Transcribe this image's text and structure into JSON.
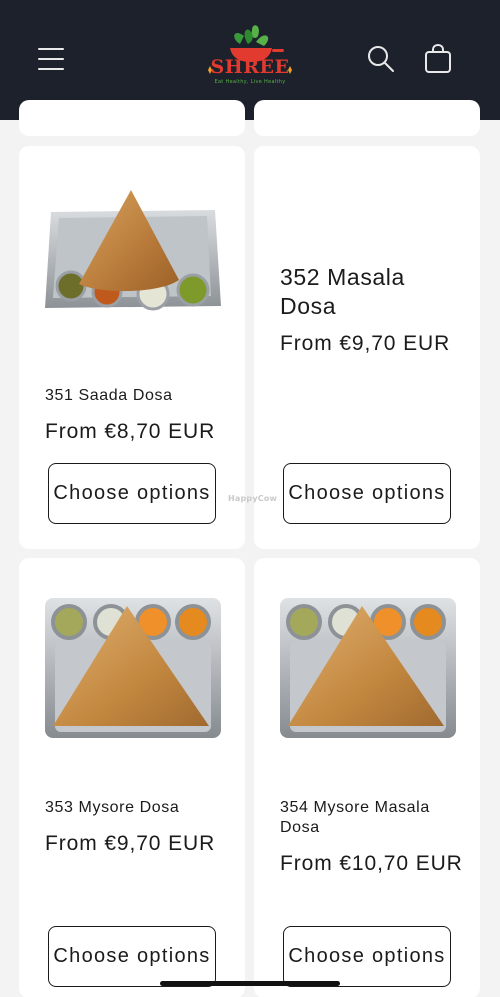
{
  "header": {
    "logo_text": "SHREE",
    "logo_tagline": "Eat Healthy, Live Healthy",
    "background": "#1c212b",
    "icons": [
      "menu-icon",
      "search-icon",
      "cart-icon"
    ]
  },
  "products": [
    {
      "name": "351 Saada Dosa",
      "price": "From €8,70 EUR",
      "button": "Choose options",
      "has_image": true
    },
    {
      "name": "352 Masala Dosa",
      "price": "From €9,70 EUR",
      "button": "Choose options",
      "has_image": false
    },
    {
      "name": "353 Mysore Dosa",
      "price": "From €9,70 EUR",
      "button": "Choose options",
      "has_image": true
    },
    {
      "name": "354 Mysore Masala Dosa",
      "price": "From €10,70 EUR",
      "button": "Choose options",
      "has_image": true
    }
  ],
  "watermark": "HappyCow",
  "colors": {
    "logo_red": "#e23a2e",
    "logo_green": "#58b048",
    "page_bg": "#f3f3f3"
  }
}
